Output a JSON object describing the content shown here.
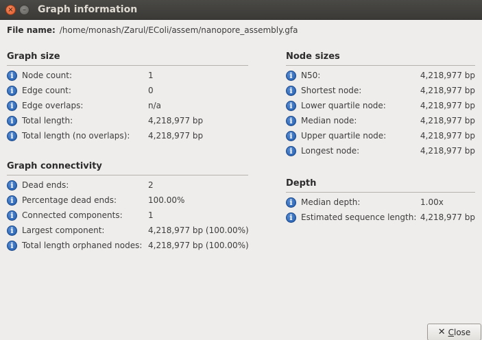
{
  "window": {
    "title": "Graph information",
    "close_glyph": "×",
    "minimize_glyph": "–"
  },
  "file": {
    "label": "File name:",
    "path": "/home/monash/Zarul/EColi/assem/nanopore_assembly.gfa"
  },
  "graph_size": {
    "title": "Graph size",
    "rows": [
      {
        "label": "Node count:",
        "value": "1"
      },
      {
        "label": "Edge count:",
        "value": "0"
      },
      {
        "label": "Edge overlaps:",
        "value": "n/a"
      },
      {
        "label": "Total length:",
        "value": "4,218,977 bp"
      },
      {
        "label": "Total length (no overlaps):",
        "value": "4,218,977 bp"
      }
    ]
  },
  "graph_connectivity": {
    "title": "Graph connectivity",
    "rows": [
      {
        "label": "Dead ends:",
        "value": "2"
      },
      {
        "label": "Percentage dead ends:",
        "value": "100.00%"
      },
      {
        "label": "Connected components:",
        "value": "1"
      },
      {
        "label": "Largest component:",
        "value": "4,218,977 bp (100.00%)"
      },
      {
        "label": "Total length orphaned nodes:",
        "value": "4,218,977 bp (100.00%)"
      }
    ]
  },
  "node_sizes": {
    "title": "Node sizes",
    "rows": [
      {
        "label": "N50:",
        "value": "4,218,977 bp"
      },
      {
        "label": "Shortest node:",
        "value": "4,218,977 bp"
      },
      {
        "label": "Lower quartile node:",
        "value": "4,218,977 bp"
      },
      {
        "label": "Median node:",
        "value": "4,218,977 bp"
      },
      {
        "label": "Upper quartile node:",
        "value": "4,218,977 bp"
      },
      {
        "label": "Longest node:",
        "value": "4,218,977 bp"
      }
    ]
  },
  "depth": {
    "title": "Depth",
    "rows": [
      {
        "label": "Median depth:",
        "value": "1.00x"
      },
      {
        "label": "Estimated sequence length:",
        "value": "4,218,977 bp"
      }
    ]
  },
  "info_icon_glyph": "i",
  "close_button": {
    "icon_glyph": "✕",
    "mnemonic": "C",
    "rest": "lose"
  }
}
